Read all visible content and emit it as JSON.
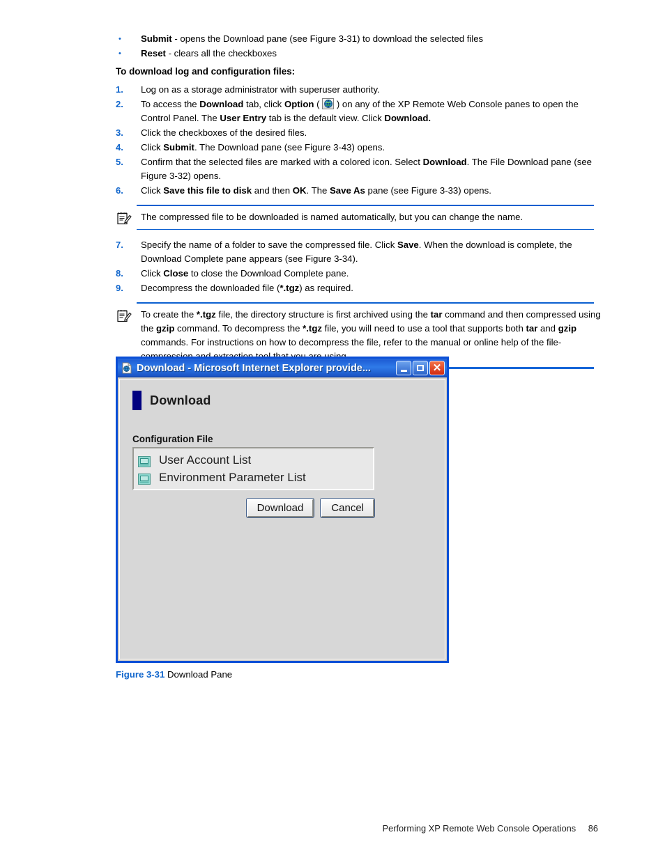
{
  "page": {
    "footer_text": "Performing XP Remote Web Console Operations",
    "page_number": "86",
    "accent_blue": "#1166cc",
    "rule_blue": "#0a5fd0"
  },
  "bullets": [
    {
      "bold": "Submit",
      "rest": " - opens the Download pane (see Figure 3-31) to download the selected files",
      "marker": "•"
    },
    {
      "bold": "Reset",
      "rest": " - clears all the checkboxes",
      "marker": "•"
    }
  ],
  "subheading": "To download log and configuration files:",
  "steps": [
    {
      "num": "1.",
      "text": "Log on as a storage administrator with superuser authority."
    },
    {
      "num": "2.",
      "text": "To access the Download tab, click Option ( [icon] ) on any of the XP Remote Web Console panes to open the Control Panel. The User Entry tab is the default view. Click Download."
    },
    {
      "num": "3.",
      "text": "Click the checkboxes of the desired files."
    },
    {
      "num": "4.",
      "text": "Click Submit. The Download pane (see Figure 3-43) opens."
    },
    {
      "num": "5.",
      "text": "Confirm that the selected files are marked with a colored icon. Select Download. The File Download pane (see Figure 3-32) opens."
    },
    {
      "num": "6.",
      "text": "Click Save this file to disk and then OK. The Save As pane (see Figure 3-33) opens."
    },
    {
      "num": "7.",
      "text": "Specify the name of a folder to save the compressed file. Click Save. When the download is complete, the Download Complete pane appears (see Figure 3-34)."
    },
    {
      "num": "8.",
      "text": "Click Close to close the Download Complete pane."
    },
    {
      "num": "9.",
      "text": "Decompress the downloaded file (*.tgz) as required."
    }
  ],
  "notes": [
    {
      "id": "note-1",
      "text": "The compressed file to be downloaded is named automatically, but you can change the name."
    },
    {
      "id": "note-2",
      "text": "To create the *.tgz file, the directory structure is first archived using the tar command and then compressed using the gzip command. To decompress the *.tgz file, you will need to use a tool that supports both tar and gzip commands. For instructions on how to decompress the file, refer to the manual or online help of the file-compression and extraction tool that you are using."
    }
  ],
  "screenshot": {
    "window_title": "Download - Microsoft Internet Explorer provide...",
    "title_icon": "ie-document-icon",
    "buttons": {
      "minimize": "minimize-icon",
      "maximize": "maximize-icon",
      "close": "close-icon"
    },
    "pane_title": "Download",
    "group_label": "Configuration File",
    "list_items": [
      "User Account List",
      "Environment Parameter List"
    ],
    "actions": {
      "download": "Download",
      "cancel": "Cancel"
    }
  },
  "figure": {
    "number": "Figure 3-31",
    "title": "Download Pane"
  }
}
